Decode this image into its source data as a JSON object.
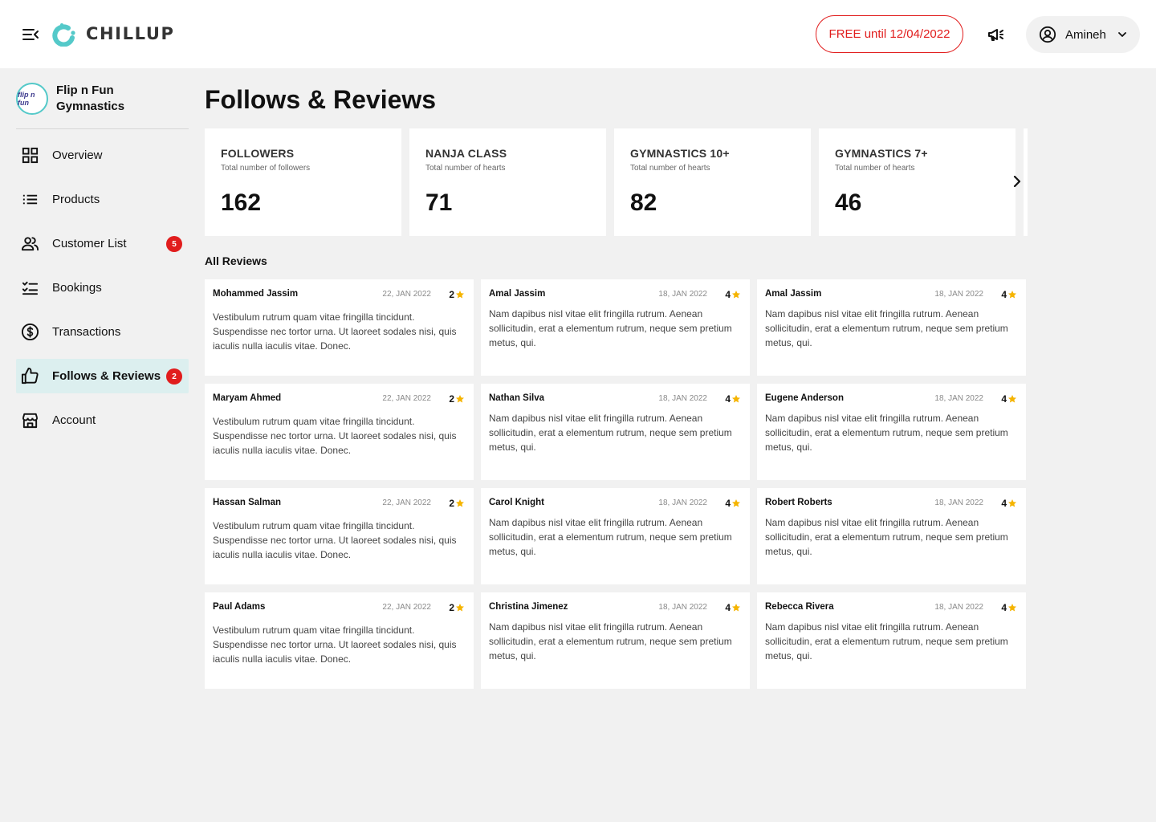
{
  "header": {
    "brand": "CHILLUP",
    "trial_label": "FREE until 12/04/2022",
    "user_name": "Amineh"
  },
  "sidebar": {
    "business_logo_text": "flip n fun",
    "business_name": "Flip n Fun Gymnastics",
    "items": [
      {
        "label": "Overview",
        "icon": "grid-icon"
      },
      {
        "label": "Products",
        "icon": "list-icon"
      },
      {
        "label": "Customer List",
        "icon": "users-icon",
        "badge": "5"
      },
      {
        "label": "Bookings",
        "icon": "checklist-icon"
      },
      {
        "label": "Transactions",
        "icon": "dollar-icon"
      },
      {
        "label": "Follows & Reviews",
        "icon": "thumbs-up-icon",
        "badge": "2",
        "active": true
      },
      {
        "label": "Account",
        "icon": "store-icon"
      }
    ]
  },
  "page": {
    "title": "Follows & Reviews",
    "reviews_title": "All Reviews"
  },
  "stats": [
    {
      "title": "FOLLOWERS",
      "subtitle": "Total number of followers",
      "value": "162"
    },
    {
      "title": "NANJA CLASS",
      "subtitle": "Total number of hearts",
      "value": "71"
    },
    {
      "title": "GYMNASTICS 10+",
      "subtitle": "Total number of hearts",
      "value": "82"
    },
    {
      "title": "GYMNASTICS 7+",
      "subtitle": "Total number of hearts",
      "value": "46"
    }
  ],
  "reviews": [
    {
      "name": "Mohammed Jassim",
      "date": "22, JAN 2022",
      "rating": "2",
      "text": "Vestibulum rutrum quam vitae fringilla tincidunt. Suspendisse nec tortor urna. Ut laoreet sodales nisi, quis iaculis nulla iaculis vitae. Donec."
    },
    {
      "name": "Amal Jassim",
      "date": "18, JAN 2022",
      "rating": "4",
      "text": "Nam dapibus nisl vitae elit fringilla rutrum. Aenean sollicitudin, erat a elementum rutrum, neque sem pretium metus, qui."
    },
    {
      "name": "Amal Jassim",
      "date": "18, JAN 2022",
      "rating": "4",
      "text": "Nam dapibus nisl vitae elit fringilla rutrum. Aenean sollicitudin, erat a elementum rutrum, neque sem pretium metus, qui."
    },
    {
      "name": "Maryam Ahmed",
      "date": "22, JAN 2022",
      "rating": "2",
      "text": "Vestibulum rutrum quam vitae fringilla tincidunt. Suspendisse nec tortor urna. Ut laoreet sodales nisi, quis iaculis nulla iaculis vitae. Donec."
    },
    {
      "name": "Nathan Silva",
      "date": "18, JAN 2022",
      "rating": "4",
      "text": "Nam dapibus nisl vitae elit fringilla rutrum. Aenean sollicitudin, erat a elementum rutrum, neque sem pretium metus, qui."
    },
    {
      "name": "Eugene Anderson",
      "date": "18, JAN 2022",
      "rating": "4",
      "text": "Nam dapibus nisl vitae elit fringilla rutrum. Aenean sollicitudin, erat a elementum rutrum, neque sem pretium metus, qui."
    },
    {
      "name": "Hassan Salman",
      "date": "22, JAN 2022",
      "rating": "2",
      "text": "Vestibulum rutrum quam vitae fringilla tincidunt. Suspendisse nec tortor urna. Ut laoreet sodales nisi, quis iaculis nulla iaculis vitae. Donec."
    },
    {
      "name": "Carol Knight",
      "date": "18, JAN 2022",
      "rating": "4",
      "text": "Nam dapibus nisl vitae elit fringilla rutrum. Aenean sollicitudin, erat a elementum rutrum, neque sem pretium metus, qui."
    },
    {
      "name": "Robert Roberts",
      "date": "18, JAN 2022",
      "rating": "4",
      "text": "Nam dapibus nisl vitae elit fringilla rutrum. Aenean sollicitudin, erat a elementum rutrum, neque sem pretium metus, qui."
    },
    {
      "name": "Paul Adams",
      "date": "22, JAN 2022",
      "rating": "2",
      "text": "Vestibulum rutrum quam vitae fringilla tincidunt. Suspendisse nec tortor urna. Ut laoreet sodales nisi, quis iaculis nulla iaculis vitae. Donec."
    },
    {
      "name": "Christina Jimenez",
      "date": "18, JAN 2022",
      "rating": "4",
      "text": "Nam dapibus nisl vitae elit fringilla rutrum. Aenean sollicitudin, erat a elementum rutrum, neque sem pretium metus, qui."
    },
    {
      "name": "Rebecca Rivera",
      "date": "18, JAN 2022",
      "rating": "4",
      "text": "Nam dapibus nisl vitae elit fringilla rutrum. Aenean sollicitudin, erat a elementum rutrum, neque sem pretium metus, qui."
    }
  ],
  "colors": {
    "accent": "#e11d1d",
    "brand_teal": "#54c9c9",
    "active_nav_bg": "#dcefef",
    "star": "#f5b400"
  }
}
